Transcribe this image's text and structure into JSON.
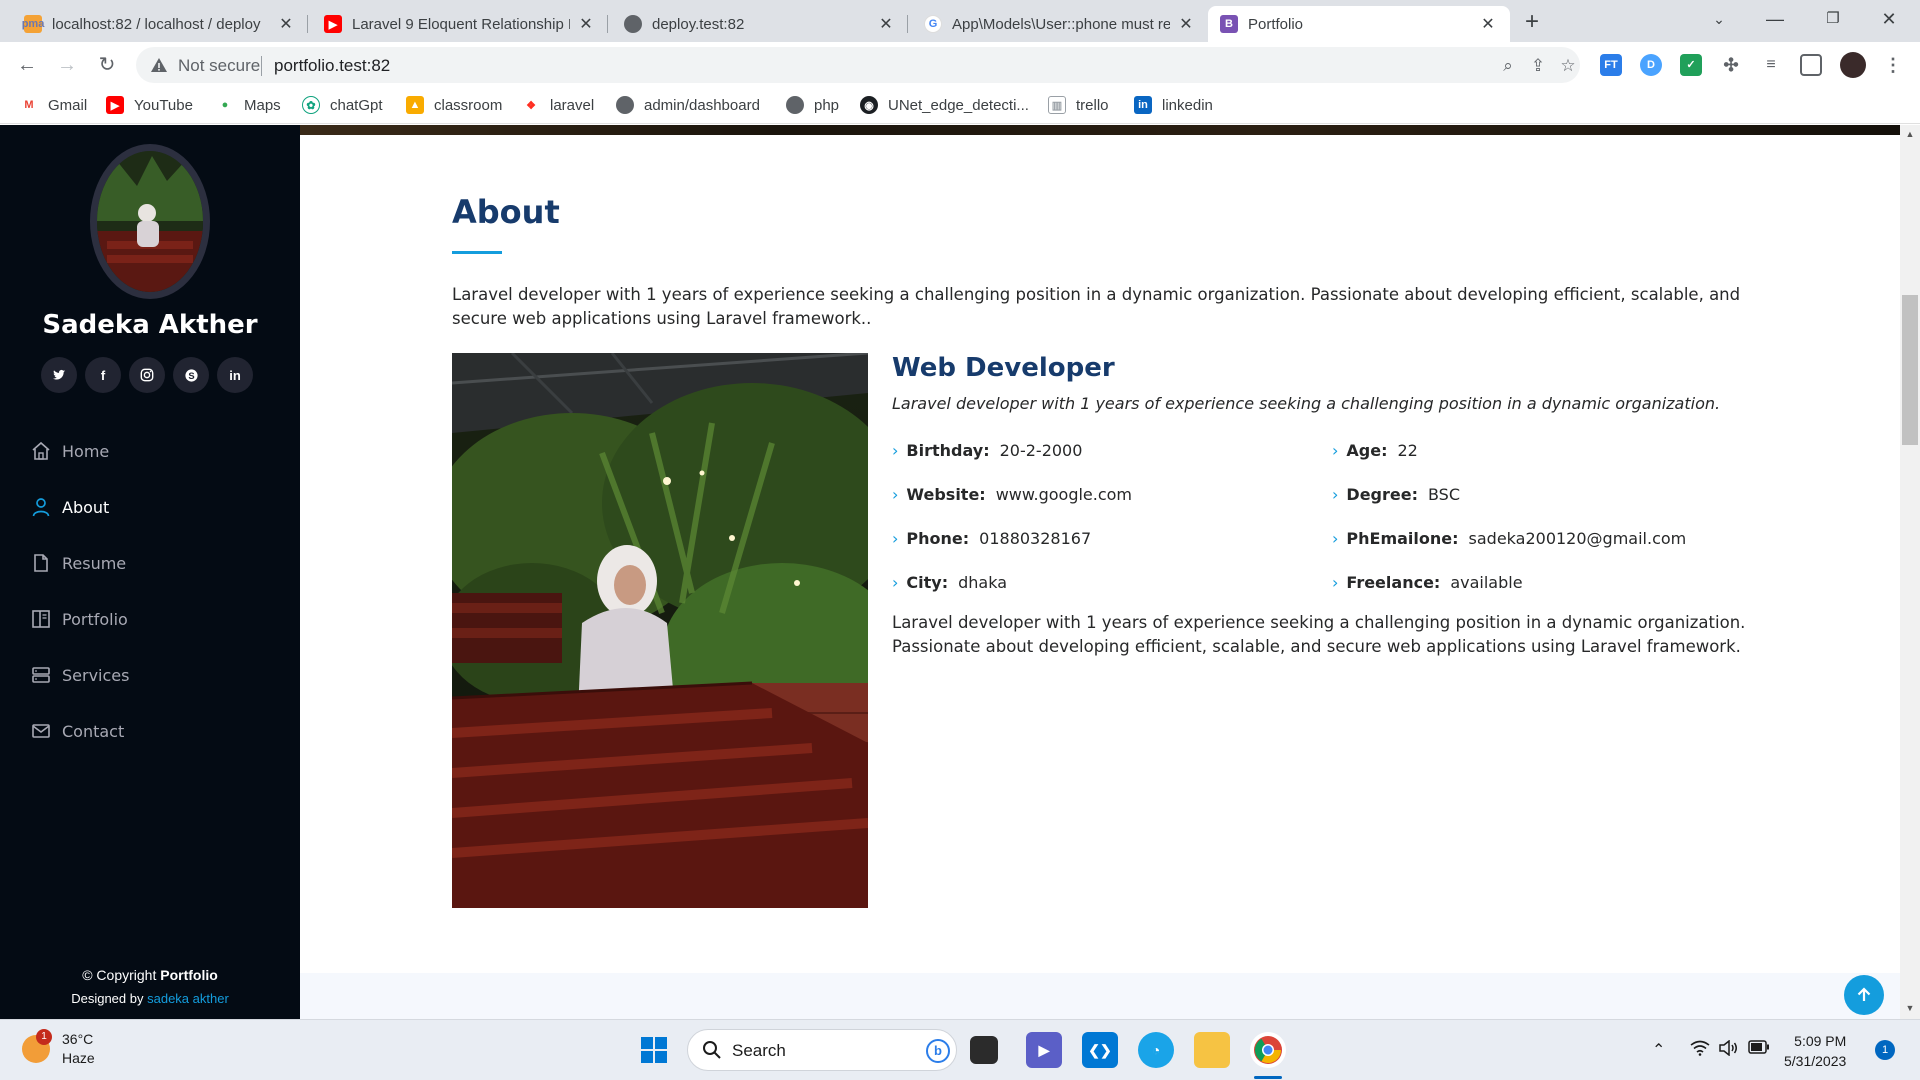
{
  "browser": {
    "tabs": [
      {
        "title": "localhost:82 / localhost / deploy",
        "favicon": "phpmyadmin-icon"
      },
      {
        "title": "Laravel 9 Eloquent Relationship B",
        "favicon": "youtube-icon"
      },
      {
        "title": "deploy.test:82",
        "favicon": "globe-icon"
      },
      {
        "title": "App\\Models\\User::phone must re",
        "favicon": "google-icon"
      },
      {
        "title": "Portfolio",
        "favicon": "bootstrap-icon"
      }
    ],
    "security_label": "Not secure",
    "url": "portfolio.test:82",
    "bookmarks": [
      {
        "label": "Gmail",
        "icon": "gmail-icon"
      },
      {
        "label": "YouTube",
        "icon": "youtube-icon"
      },
      {
        "label": "Maps",
        "icon": "maps-icon"
      },
      {
        "label": "chatGpt",
        "icon": "chatgpt-icon"
      },
      {
        "label": "classroom",
        "icon": "classroom-icon"
      },
      {
        "label": "laravel",
        "icon": "laravel-icon"
      },
      {
        "label": "admin/dashboard",
        "icon": "globe-icon"
      },
      {
        "label": "php",
        "icon": "globe-icon"
      },
      {
        "label": "UNet_edge_detecti...",
        "icon": "github-icon"
      },
      {
        "label": "trello",
        "icon": "trello-icon"
      },
      {
        "label": "linkedin",
        "icon": "linkedin-icon"
      }
    ]
  },
  "sidebar": {
    "name": "Sadeka Akther",
    "socials": [
      "twitter-icon",
      "facebook-icon",
      "instagram-icon",
      "skype-icon",
      "linkedin-icon"
    ],
    "menu": [
      {
        "label": "Home",
        "icon": "home-icon",
        "active": false
      },
      {
        "label": "About",
        "icon": "person-icon",
        "active": true
      },
      {
        "label": "Resume",
        "icon": "file-icon",
        "active": false
      },
      {
        "label": "Portfolio",
        "icon": "book-icon",
        "active": false
      },
      {
        "label": "Services",
        "icon": "server-icon",
        "active": false
      },
      {
        "label": "Contact",
        "icon": "envelope-icon",
        "active": false
      }
    ],
    "footer": {
      "copyright_prefix": "© Copyright",
      "copyright_brand": "Portfolio",
      "designed_by": "Designed by",
      "designer": "sadeka akther"
    }
  },
  "about": {
    "title": "About",
    "intro": "Laravel developer with 1 years of experience seeking a challenging position in a dynamic organization. Passionate about developing efficient, scalable, and secure web applications using Laravel framework..",
    "role": "Web Developer",
    "role_summary": "Laravel developer with 1 years of experience seeking a challenging position in a dynamic organization.",
    "facts_left": [
      {
        "label": "Birthday:",
        "value": "20-2-2000"
      },
      {
        "label": "Website:",
        "value": "www.google.com"
      },
      {
        "label": "Phone:",
        "value": "01880328167"
      },
      {
        "label": "City:",
        "value": "dhaka"
      }
    ],
    "facts_right": [
      {
        "label": "Age:",
        "value": "22"
      },
      {
        "label": "Degree:",
        "value": "BSC"
      },
      {
        "label": "PhEmailone:",
        "value": "sadeka200120@gmail.com"
      },
      {
        "label": "Freelance:",
        "value": "available"
      }
    ],
    "description": "Laravel developer with 1 years of experience seeking a challenging position in a dynamic organization. Passionate about developing efficient, scalable, and secure web applications using Laravel framework."
  },
  "taskbar": {
    "weather": {
      "temp": "36°C",
      "condition": "Haze",
      "badge": "1"
    },
    "search_label": "Search",
    "time": "5:09 PM",
    "date": "5/31/2023",
    "notifications": "1"
  },
  "colors": {
    "accent": "#149ddd",
    "heading": "#173b6c",
    "sidebar_bg": "#040b14"
  }
}
